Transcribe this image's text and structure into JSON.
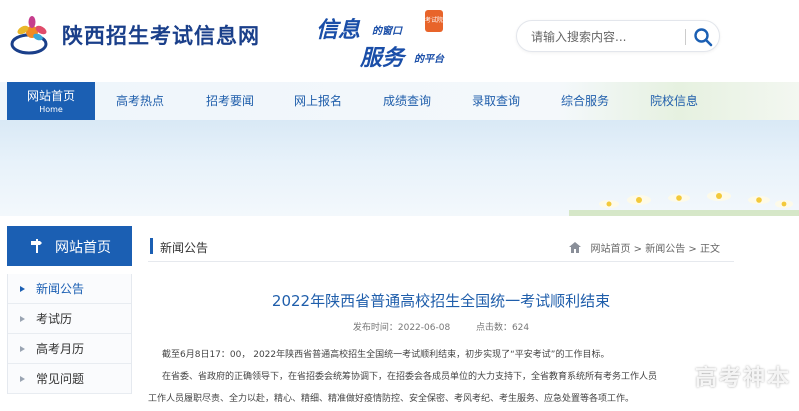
{
  "header": {
    "site_title": "陕西招生考试信息网",
    "slogan_line1": "信息",
    "slogan_line1_small": "的窗口",
    "slogan_line2": "服务",
    "slogan_line2_small": "的平台",
    "slogan_seal": "考试院"
  },
  "search": {
    "placeholder": "请输入搜索内容...",
    "button_icon": "search-icon"
  },
  "nav": {
    "home_label": "网站首页",
    "home_sub": "Home",
    "items": [
      "高考热点",
      "招考要闻",
      "网上报名",
      "成绩查询",
      "录取查询",
      "综合服务",
      "院校信息"
    ]
  },
  "sidebar": {
    "title": "网站首页",
    "items": [
      {
        "label": "新闻公告",
        "active": true
      },
      {
        "label": "考试历",
        "active": false
      },
      {
        "label": "高考月历",
        "active": false
      },
      {
        "label": "常见问题",
        "active": false
      }
    ]
  },
  "content": {
    "section": "新闻公告",
    "breadcrumb": [
      "网站首页",
      "新闻公告",
      "正文"
    ],
    "breadcrumb_sep": ">",
    "title": "2022年陕西省普通高校招生全国统一考试顺利结束",
    "date_label": "发布时间：",
    "date": "2022-06-08",
    "views_label": "点击数：",
    "views": "624",
    "paragraphs": [
      "截至6月8日17：00，  2022年陕西省普通高校招生全国统一考试顺利结束，初步实现了“平安考试”的工作目标。",
      "在省委、省政府的正确领导下，在省招委会统筹协调下，在招委会各成员单位的大力支持下，全省教育系统所有考务工作人员",
      "工作人员履职尽责、全力以赴，精心、精细、精准做好疫情防控、安全保密、考风考纪、考生服务、应急处置等各项工作。"
    ]
  },
  "watermark": "高考神本",
  "colors": {
    "brand_blue": "#1b5fb3",
    "link_blue": "#1f5eab"
  }
}
